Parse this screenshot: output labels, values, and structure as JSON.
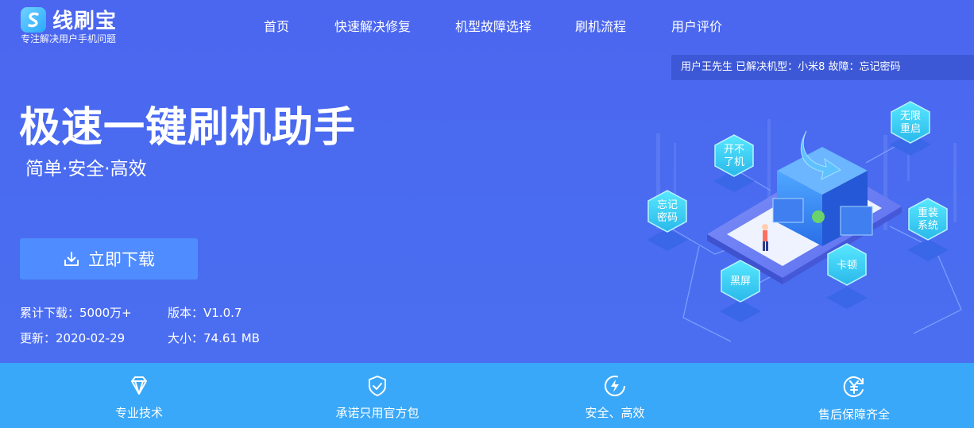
{
  "header": {
    "logo_text": "线刷宝",
    "logo_tagline": "专注解决用户手机问题",
    "logo_icon": "s-logo-icon",
    "nav": [
      "首页",
      "快速解决修复",
      "机型故障选择",
      "刷机流程",
      "用户评价"
    ]
  },
  "ticker": {
    "text": "用户王先生 已解决机型：小米8 故障：忘记密码"
  },
  "hero": {
    "headline": "极速一键刷机助手",
    "subline": "简单·安全·高效",
    "download_label": "立即下载",
    "download_icon": "download-icon",
    "meta": {
      "downloads": "累计下载：5000万+",
      "version": "版本：V1.0.7",
      "updated": "更新：2020-02-29",
      "size": "大小：74.61 MB"
    }
  },
  "illustration": {
    "badges": [
      "无限重启",
      "开不了机",
      "忘记密码",
      "重装系统",
      "黑屏",
      "卡顿"
    ]
  },
  "features": [
    {
      "label": "专业技术",
      "icon": "diamond-icon"
    },
    {
      "label": "承诺只用官方包",
      "icon": "shield-check-icon"
    },
    {
      "label": "安全、高效",
      "icon": "lightning-icon"
    },
    {
      "label": "售后保障齐全",
      "icon": "yen-refresh-icon"
    }
  ],
  "colors": {
    "hero_bg": "#4a6cf0",
    "ticker_bg": "#3d58d6",
    "button_bg": "#4f8cff",
    "feature_bar_bg": "#3aa8f8",
    "badge_cyan": "#35d8f2"
  }
}
